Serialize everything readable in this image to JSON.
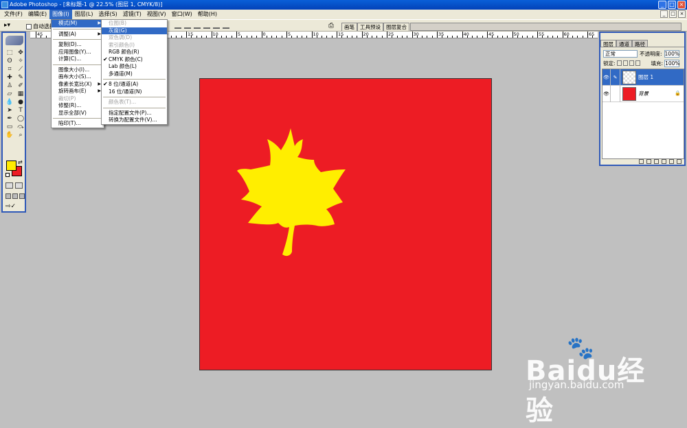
{
  "app": {
    "title": "Adobe Photoshop - [未标题-1 @ 22.5% (图层 1, CMYK/8)]",
    "min": "_",
    "max": "□",
    "close": "×"
  },
  "menubar": [
    "文件(F)",
    "编辑(E)",
    "图像(I)",
    "图层(L)",
    "选择(S)",
    "滤镜(T)",
    "视图(V)",
    "窗口(W)",
    "帮助(H)"
  ],
  "options": {
    "auto_select": "自动选择",
    "wells": [
      "画笔",
      "工具预设",
      "图层复合"
    ]
  },
  "ruler": [
    {
      "v": "45"
    },
    {
      "v": "40"
    },
    {
      "v": "35"
    },
    {
      "v": "30"
    },
    {
      "v": "25"
    },
    {
      "v": "20"
    },
    {
      "v": "15"
    },
    {
      "v": "10"
    },
    {
      "v": "5"
    },
    {
      "v": "0"
    },
    {
      "v": "5"
    },
    {
      "v": "10"
    },
    {
      "v": "15"
    },
    {
      "v": "20"
    },
    {
      "v": "25"
    },
    {
      "v": "30"
    },
    {
      "v": "35"
    },
    {
      "v": "40"
    },
    {
      "v": "45"
    },
    {
      "v": "50"
    },
    {
      "v": "55"
    },
    {
      "v": "60"
    },
    {
      "v": "65"
    }
  ],
  "image_menu": [
    {
      "label": "模式(M)",
      "state": "hl",
      "submenu": true
    },
    {
      "sep": true
    },
    {
      "label": "调整(A)",
      "submenu": true
    },
    {
      "sep": true
    },
    {
      "label": "复制(D)..."
    },
    {
      "label": "应用图像(Y)..."
    },
    {
      "label": "计算(C)..."
    },
    {
      "sep": true
    },
    {
      "label": "图像大小(I)..."
    },
    {
      "label": "画布大小(S)..."
    },
    {
      "label": "像素长宽比(X)",
      "submenu": true
    },
    {
      "label": "旋转画布(E)",
      "submenu": true
    },
    {
      "label": "裁切(P)",
      "state": "dis"
    },
    {
      "label": "修整(R)..."
    },
    {
      "label": "显示全部(V)"
    },
    {
      "sep": true
    },
    {
      "label": "陷印(T)..."
    }
  ],
  "mode_menu": [
    {
      "label": "位图(B)",
      "state": "dis"
    },
    {
      "label": "灰度(G)",
      "state": "hl"
    },
    {
      "label": "双色调(D)",
      "state": "dis"
    },
    {
      "label": "索引颜色(I)",
      "state": "dis"
    },
    {
      "label": "RGB 颜色(R)"
    },
    {
      "label": "CMYK 颜色(C)",
      "checked": true
    },
    {
      "label": "Lab 颜色(L)"
    },
    {
      "label": "多通道(M)"
    },
    {
      "sep": true
    },
    {
      "label": "8 位/通道(A)",
      "checked": true
    },
    {
      "label": "16 位/通道(N)"
    },
    {
      "sep": true
    },
    {
      "label": "颜色表(T)...",
      "state": "dis"
    },
    {
      "sep": true
    },
    {
      "label": "指定配置文件(P)..."
    },
    {
      "label": "转换为配置文件(V)..."
    }
  ],
  "layers_panel": {
    "tabs": [
      "图层",
      "通道",
      "路径"
    ],
    "blend_mode": "正常",
    "opacity_label": "不透明度:",
    "opacity": "100%",
    "lock_label": "锁定:",
    "fill_label": "填充:",
    "fill": "100%",
    "layers": [
      {
        "name": "图层 1",
        "selected": true
      },
      {
        "name": "背景",
        "selected": false,
        "locked": true
      }
    ]
  },
  "toolbox": {
    "foreground_color": "#ffeb00",
    "background_color": "#ed1c24"
  },
  "canvas": {
    "background_color": "#ed1c24",
    "leaf_color": "#ffee00"
  },
  "watermark": {
    "logo_text": "Baidu经验",
    "url": "jingyan.baidu.com"
  }
}
